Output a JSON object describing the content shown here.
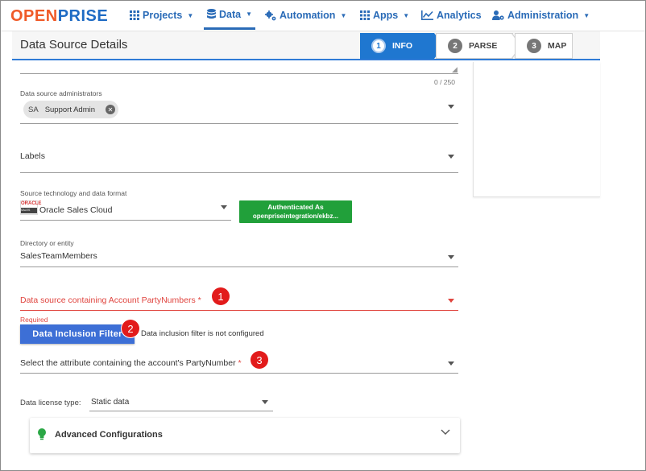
{
  "nav": {
    "logo_open": "OPEN",
    "logo_prise": "PRISE",
    "items": [
      {
        "label": "Projects",
        "icon": "grid-icon"
      },
      {
        "label": "Data",
        "icon": "database-icon"
      },
      {
        "label": "Automation",
        "icon": "cog-icon"
      },
      {
        "label": "Apps",
        "icon": "apps-grid-icon"
      },
      {
        "label": "Analytics",
        "icon": "chart-icon"
      },
      {
        "label": "Administration",
        "icon": "users-cog-icon"
      }
    ],
    "accent": "#2a6bb7"
  },
  "header": {
    "title": "Data Source Details",
    "steps": [
      {
        "num": "1",
        "label": "INFO"
      },
      {
        "num": "2",
        "label": "PARSE"
      },
      {
        "num": "3",
        "label": "MAP"
      }
    ]
  },
  "form": {
    "char_counter": "0 / 250",
    "admins": {
      "label": "Data source administrators",
      "chip_abbr": "SA",
      "chip_name": "Support Admin"
    },
    "labels_field": {
      "label": "Labels"
    },
    "source_tech": {
      "label": "Source technology and data format",
      "value": "Oracle Sales Cloud",
      "logo_text_top": "ORACLE",
      "logo_text_bottom": "SALES CLOUD",
      "auth_line1": "Authenticated As",
      "auth_line2": "openpriseintegration/ekbz..."
    },
    "directory": {
      "label": "Directory or entity",
      "value": "SalesTeamMembers"
    },
    "account_source": {
      "label": "Data source containing Account PartyNumbers",
      "star": "*",
      "required_text": "Required"
    },
    "filter": {
      "button": "Data Inclusion Filter",
      "note": "Data inclusion filter is not configured"
    },
    "attribute": {
      "label": "Select the attribute containing the account's PartyNumber",
      "star": "*"
    },
    "license": {
      "label": "Data license type:",
      "value": "Static data"
    },
    "advanced": {
      "title": "Advanced Configurations"
    }
  },
  "annotations": [
    "1",
    "2",
    "3"
  ]
}
